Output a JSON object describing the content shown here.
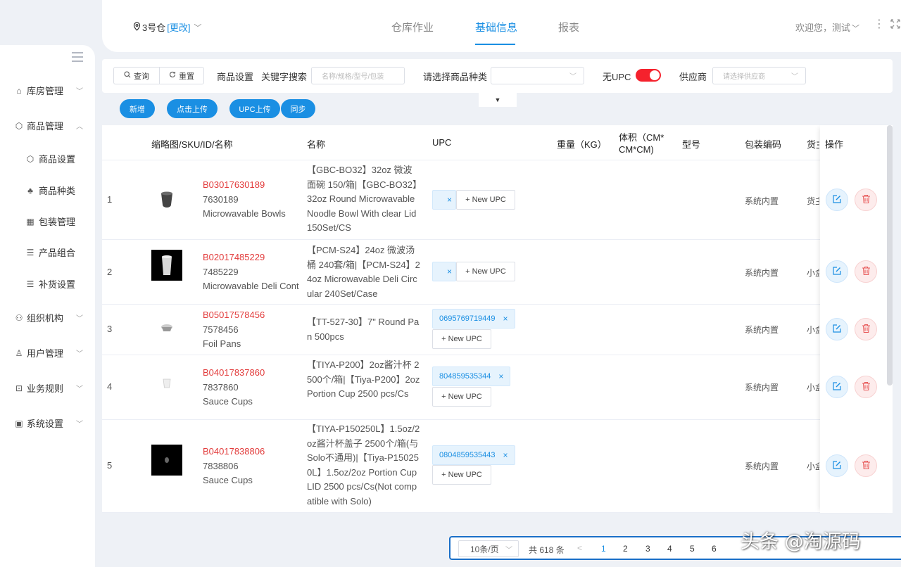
{
  "header": {
    "warehouse": "3号仓",
    "change": "[更改]",
    "tabs": [
      "仓库作业",
      "基础信息",
      "报表"
    ],
    "welcome": "欢迎您，测试"
  },
  "sidebar": {
    "items": [
      {
        "label": "库房管理",
        "icon": "home-icon",
        "arrow": "﹀"
      },
      {
        "label": "商品管理",
        "icon": "cube-icon",
        "arrow": "︿"
      },
      {
        "label": "组织机构",
        "icon": "org-icon",
        "arrow": "﹀"
      },
      {
        "label": "用户管理",
        "icon": "user-icon",
        "arrow": "﹀"
      },
      {
        "label": "业务规则",
        "icon": "rules-icon",
        "arrow": "﹀"
      },
      {
        "label": "系统设置",
        "icon": "settings-icon",
        "arrow": "﹀"
      }
    ],
    "subitems": [
      {
        "label": "商品设置",
        "icon": "cube-icon"
      },
      {
        "label": "商品种类",
        "icon": "category-icon"
      },
      {
        "label": "包装管理",
        "icon": "package-icon"
      },
      {
        "label": "产品组合",
        "icon": "combo-icon"
      },
      {
        "label": "补货设置",
        "icon": "replenish-icon"
      }
    ]
  },
  "filter": {
    "query": "查询",
    "reset": "重置",
    "product_settings": "商品设置",
    "keyword_label": "关键字搜索",
    "keyword_placeholder": "名称/规格/型号/包装",
    "category_label": "请选择商品种类",
    "no_upc_label": "无UPC",
    "no_upc_on": true,
    "supplier_label": "供应商",
    "supplier_placeholder": "请选择供应商",
    "collapse": "▼"
  },
  "actions": {
    "add": "新增",
    "upload": "点击上传",
    "upc_upload": "UPC上传",
    "sync": "同步"
  },
  "table": {
    "headers": {
      "thumb_sku": "缩略图/SKU/ID/名称",
      "name": "名称",
      "upc": "UPC",
      "weight": "重量（KG）",
      "volume_1": "体积（CM*",
      "volume_2": "CM*CM)",
      "model": "型号",
      "pack_code": "包装编码",
      "shelf": "货主",
      "ops": "操作"
    },
    "new_upc_label": "+ New UPC",
    "remove_glyph": "×",
    "rows": [
      {
        "index": "1",
        "sku": "B03017630189",
        "id": "7630189",
        "en_name": "Microwavable Bowls",
        "name": "【GBC-BO32】32oz 微波面碗 150/箱|【GBC-BO32】32oz Round Microwavable Noodle Bowl With clear Lid 150Set/CS",
        "upc": "",
        "pack": "系统内置",
        "shelf": "货主"
      },
      {
        "index": "2",
        "sku": "B02017485229",
        "id": "7485229",
        "en_name": "Microwavable Deli Cont",
        "name": "【PCM-S24】24oz 微波汤桶 240套/箱|【PCM-S24】24oz Microwavable Deli Circular 240Set/Case",
        "upc": "",
        "pack": "系统内置",
        "shelf": "小盒"
      },
      {
        "index": "3",
        "sku": "B05017578456",
        "id": "7578456",
        "en_name": "Foil Pans",
        "name": "【TT-527-30】7\" Round Pan 500pcs",
        "upc": "0695769719449",
        "pack": "系统内置",
        "shelf": "小盒"
      },
      {
        "index": "4",
        "sku": "B04017837860",
        "id": "7837860",
        "en_name": "Sauce Cups",
        "name": "【TIYA-P200】2oz酱汁杯 2500个/箱|【Tiya-P200】2oz Portion Cup 2500 pcs/Cs",
        "upc": "804859535344",
        "pack": "系统内置",
        "shelf": "小盒"
      },
      {
        "index": "5",
        "sku": "B04017838806",
        "id": "7838806",
        "en_name": "Sauce Cups",
        "name": "【TIYA-P150250L】1.5oz/2oz酱汁杯盖子 2500个/箱(与Solo不通用)|【Tiya-P150250L】1.5oz/2oz Portion Cup LID 2500 pcs/Cs(Not compatible with Solo)",
        "upc": "0804859535443",
        "pack": "系统内置",
        "shelf": "小盒"
      }
    ]
  },
  "pagination": {
    "page_size": "10条/页",
    "total": "共 618 条",
    "prev": "<",
    "pages": [
      "1",
      "2",
      "3",
      "4",
      "5",
      "6"
    ],
    "current": "1"
  },
  "watermark": "头条 @淘源码",
  "colors": {
    "accent": "#1a8fe3",
    "danger": "#f5222d",
    "sku_red": "#e23b3b"
  }
}
